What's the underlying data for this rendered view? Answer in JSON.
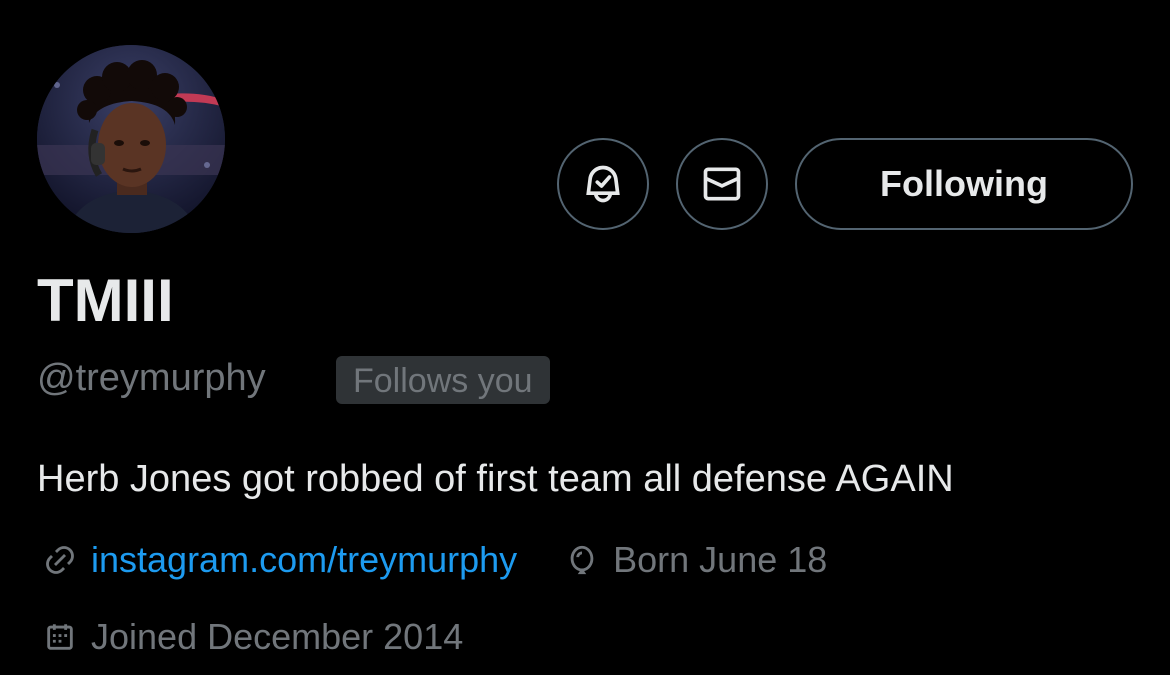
{
  "profile": {
    "display_name": "TMIII",
    "handle": "@treymurphy",
    "follows_you_label": "Follows you",
    "bio": "Herb Jones got robbed of first team all defense AGAIN",
    "website": "instagram.com/treymurphy",
    "born": "Born June 18",
    "joined": "Joined December 2014"
  },
  "actions": {
    "notifications_icon": "bell-check-icon",
    "message_icon": "envelope-icon",
    "follow_label": "Following"
  },
  "icons": {
    "website": "link-icon",
    "born": "balloon-icon",
    "joined": "calendar-icon"
  },
  "colors": {
    "background": "#000000",
    "text_primary": "#e7e9ea",
    "text_secondary": "#71767b",
    "link": "#1d9bf0",
    "badge_bg": "#2f3336",
    "border": "#536471"
  }
}
